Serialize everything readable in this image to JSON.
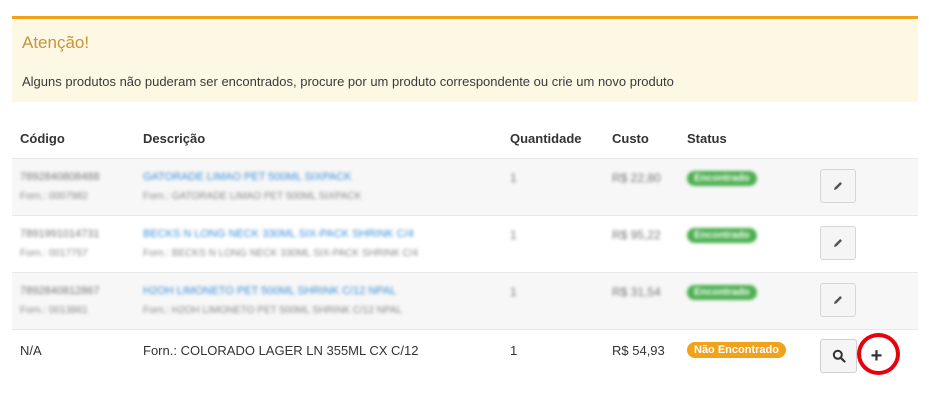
{
  "alert": {
    "title": "Atenção!",
    "message": "Alguns produtos não puderam ser encontrados, procure por um produto correspondente ou crie um novo produto"
  },
  "table": {
    "headers": {
      "code": "Código",
      "description": "Descrição",
      "quantity": "Quantidade",
      "cost": "Custo",
      "status": "Status"
    },
    "found_rows": [
      {
        "code": "7892840808488",
        "supplier_code": "Forn.: 0007982",
        "description": "GATORADE LIMAO PET 500ML SIXPACK",
        "supplier_description": "Forn.: GATORADE LIMAO PET 500ML SIXPACK",
        "quantity": "1",
        "cost": "R$ 22,80",
        "status": "Encontrado"
      },
      {
        "code": "7891991014731",
        "supplier_code": "Forn.: 0017757",
        "description": "BECKS N LONG NECK 330ML SIX-PACK SHRINK C/4",
        "supplier_description": "Forn.: BECKS N LONG NECK 330ML SIX-PACK SHRINK C/4",
        "quantity": "1",
        "cost": "R$ 95,22",
        "status": "Encontrado"
      },
      {
        "code": "7892840812867",
        "supplier_code": "Forn.: 0013861",
        "description": "H2OH LIMONETO PET 500ML SHRINK C/12 NPAL",
        "supplier_description": "Forn.: H2OH LIMONETO PET 500ML SHRINK C/12 NPAL",
        "quantity": "1",
        "cost": "R$ 31,54",
        "status": "Encontrado"
      }
    ],
    "not_found_row": {
      "code": "N/A",
      "description": "Forn.: COLORADO LAGER LN 355ML CX C/12",
      "quantity": "1",
      "cost": "R$ 54,93",
      "status": "Não Encontrado"
    }
  },
  "icons": {
    "edit": "pencil-icon",
    "search": "search-icon",
    "add": "plus-icon"
  },
  "colors": {
    "alert_border": "#f0a21b",
    "alert_bg": "#fdf8e4",
    "alert_title": "#c9943a",
    "badge_found": "#4caf50",
    "badge_not_found": "#f0a21b",
    "link": "#3b8fd8",
    "highlight": "#e8000b"
  }
}
